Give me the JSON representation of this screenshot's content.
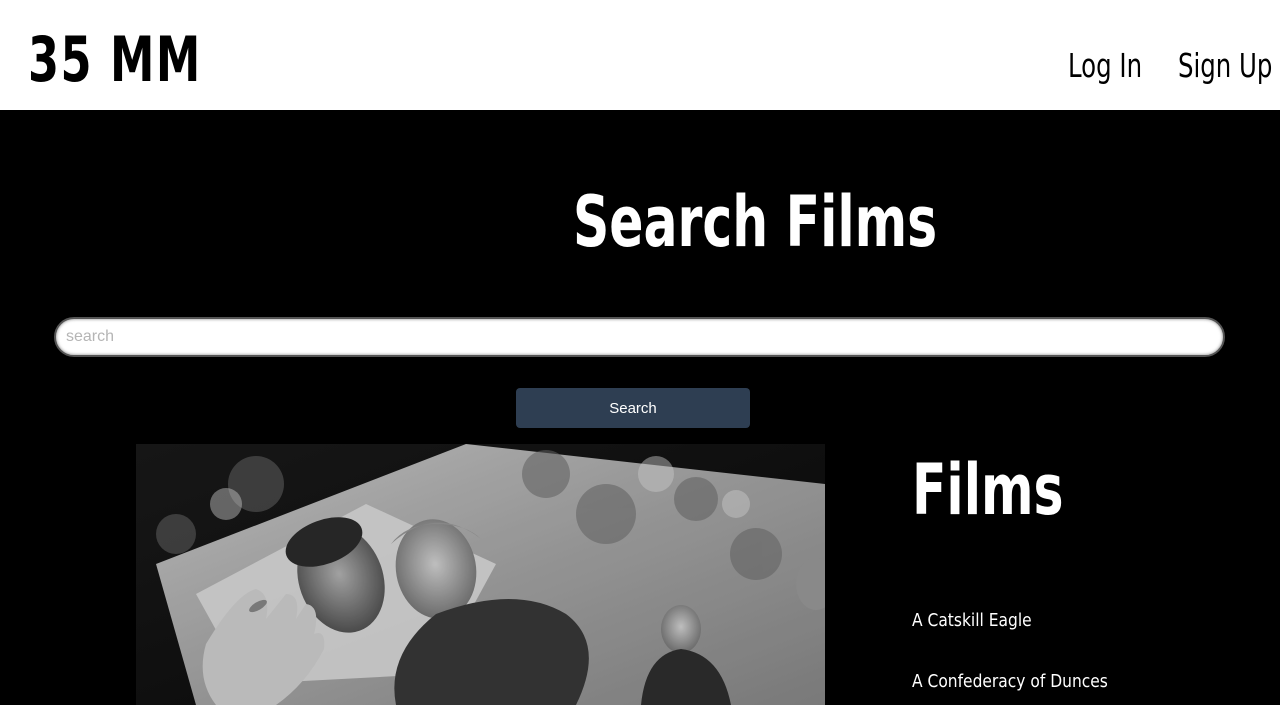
{
  "header": {
    "brand": "35 MM",
    "nav": {
      "login": "Log In",
      "signup": "Sign Up"
    }
  },
  "search": {
    "title": "Search Films",
    "placeholder": "search",
    "value": "",
    "button_label": "Search"
  },
  "films": {
    "heading": "Films",
    "items": [
      {
        "title": "A Catskill Eagle"
      },
      {
        "title": "A Confederacy of Dunces"
      }
    ]
  },
  "colors": {
    "header_bg": "#ffffff",
    "page_bg": "#000000",
    "button_bg": "#2e3e52"
  }
}
